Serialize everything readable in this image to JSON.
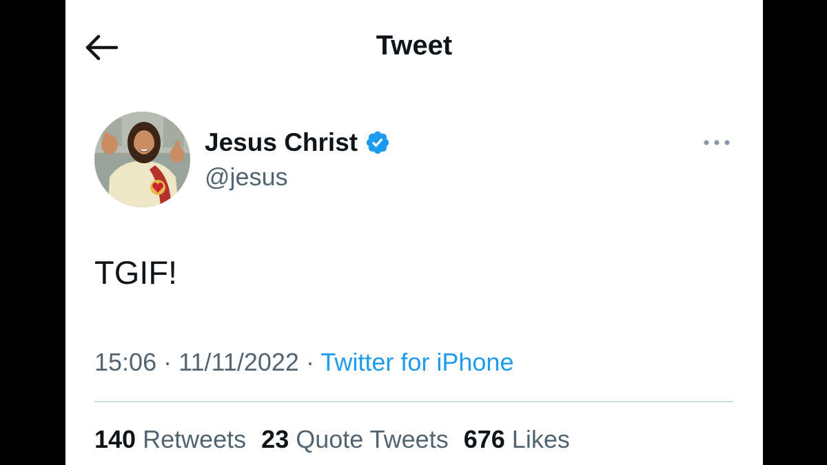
{
  "header": {
    "title": "Tweet",
    "back_icon": "arrow-left-icon"
  },
  "author": {
    "display_name": "Jesus Christ",
    "handle": "@jesus",
    "verified": true,
    "verified_color": "#1d9bf0"
  },
  "tweet": {
    "text": "TGIF!",
    "time": "15:06",
    "date": "11/11/2022",
    "source": "Twitter for iPhone",
    "separator": "·"
  },
  "stats": {
    "retweets_count": "140",
    "retweets_label": "Retweets",
    "quotes_count": "23",
    "quotes_label": "Quote Tweets",
    "likes_count": "676",
    "likes_label": "Likes"
  },
  "colors": {
    "text_primary": "#0f1419",
    "text_secondary": "#536471",
    "accent": "#1d9bf0",
    "divider": "#cfd9de"
  }
}
